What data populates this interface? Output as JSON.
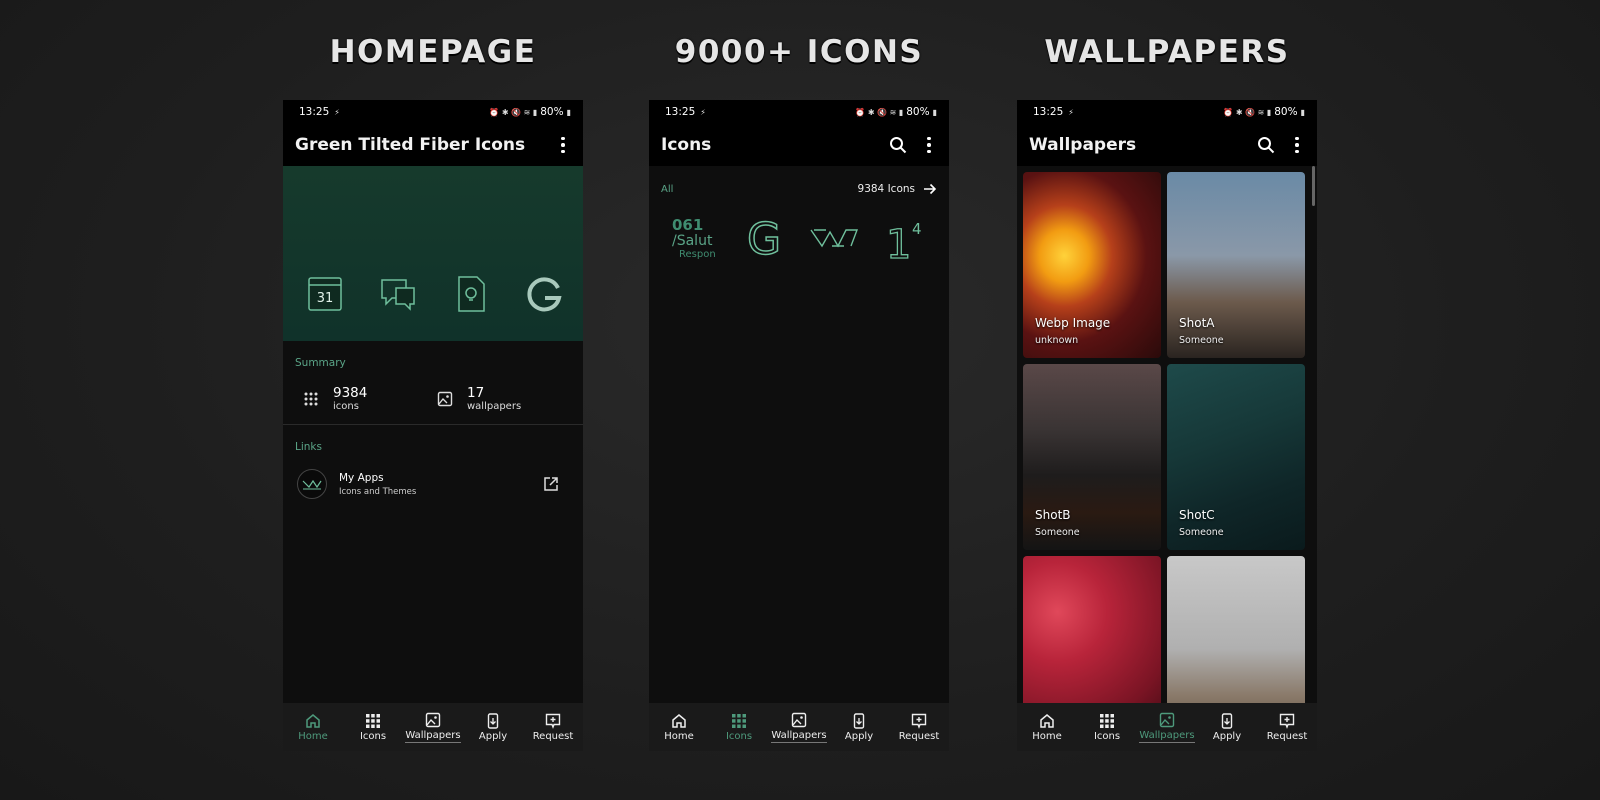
{
  "panels": {
    "homepage": {
      "caption": "HOMEPAGE",
      "status": {
        "time": "13:25",
        "battery": "80%"
      },
      "appbar_title": "Green Tilted Fiber Icons",
      "hero_icons": [
        "calendar-icon",
        "chat-icon",
        "doc-bulb-icon",
        "google-g-icon"
      ],
      "hero_calendar_day": "31",
      "summary": {
        "label": "Summary",
        "icons_count": "9384",
        "icons_label": "icons",
        "wallpapers_count": "17",
        "wallpapers_label": "wallpapers"
      },
      "links": {
        "label": "Links",
        "item_title": "My Apps",
        "item_sub": "Icons and Themes"
      }
    },
    "icons": {
      "caption": "9000+ ICONS",
      "status": {
        "time": "13:25",
        "battery": "80%"
      },
      "appbar_title": "Icons",
      "filter_label": "All",
      "count_label": "9384 Icons",
      "preview_texts": {
        "line1": "061",
        "line2": "/Salut",
        "line3": "Respon",
        "g": "G",
        "n1": "1",
        "n4": "4"
      }
    },
    "wallpapers": {
      "caption": "WALLPAPERS",
      "status": {
        "time": "13:25",
        "battery": "80%"
      },
      "appbar_title": "Wallpapers",
      "items": [
        {
          "name": "Webp Image",
          "author": "unknown"
        },
        {
          "name": "ShotA",
          "author": "Someone"
        },
        {
          "name": "ShotB",
          "author": "Someone"
        },
        {
          "name": "ShotC",
          "author": "Someone"
        },
        {
          "name": "",
          "author": ""
        },
        {
          "name": "",
          "author": ""
        }
      ]
    }
  },
  "nav": [
    "Home",
    "Icons",
    "Wallpapers",
    "Apply",
    "Request"
  ],
  "colors": {
    "accent": "#4e9a7c",
    "bg": "#0e0e0e",
    "bar": "#000000",
    "navbar": "#1a1a1a"
  }
}
